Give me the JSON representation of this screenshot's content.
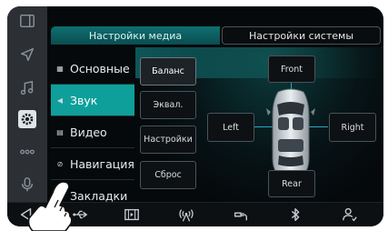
{
  "tabs": {
    "media": "Настройки медиа",
    "system": "Настройки системы"
  },
  "menu": {
    "items": [
      {
        "icon": "grid-icon",
        "label": "Основные"
      },
      {
        "icon": "speaker-icon",
        "label": "Звук"
      },
      {
        "icon": "film-icon",
        "label": "Видео"
      },
      {
        "icon": "compass-icon",
        "label": "Навигация"
      },
      {
        "icon": "bookmark-icon",
        "label": "Закладки"
      }
    ],
    "active_index": 1
  },
  "sound_panel": {
    "buttons": {
      "balance": "Баланс",
      "equalizer": "Эквал.",
      "settings": "Настройки",
      "reset": "Сброс"
    },
    "selected": "balance",
    "positions": {
      "front": "Front",
      "rear": "Rear",
      "left": "Left",
      "right": "Right"
    }
  },
  "left_sidebar": {
    "icons": [
      "window-icon",
      "navigation-arrow-icon",
      "music-note-icon",
      "gear-icon",
      "more-icon",
      "microphone-icon"
    ],
    "active": "gear-icon"
  },
  "bottom_bar": {
    "icons": [
      "back-icon",
      "usb-icon",
      "film-strip-icon",
      "antenna-icon",
      "aux-plug-icon",
      "bluetooth-icon",
      "user-profile-icon"
    ]
  },
  "colors": {
    "accent": "#0e9f9b",
    "balance_line": "#2aa7c9",
    "background": "#05090b"
  }
}
